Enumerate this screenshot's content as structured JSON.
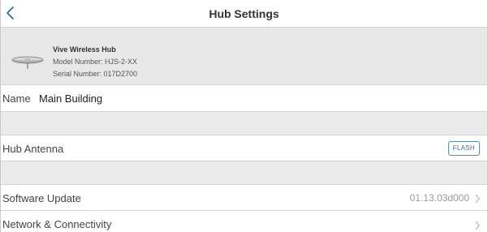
{
  "nav": {
    "title": "Hub Settings"
  },
  "device": {
    "name": "Vive Wireless Hub",
    "model": "Model Number: HJS-2-XX",
    "serial": "Serial Number: 017D2700"
  },
  "name_row": {
    "label": "Name",
    "value": "Main Building"
  },
  "antenna_row": {
    "label": "Hub Antenna",
    "button": "FLASH"
  },
  "software_row": {
    "label": "Software Update",
    "value": "01.13.03d000"
  },
  "network_row": {
    "label": "Network & Connectivity"
  },
  "colors": {
    "accent": "#1f6fc4",
    "background": "#ebebeb"
  }
}
